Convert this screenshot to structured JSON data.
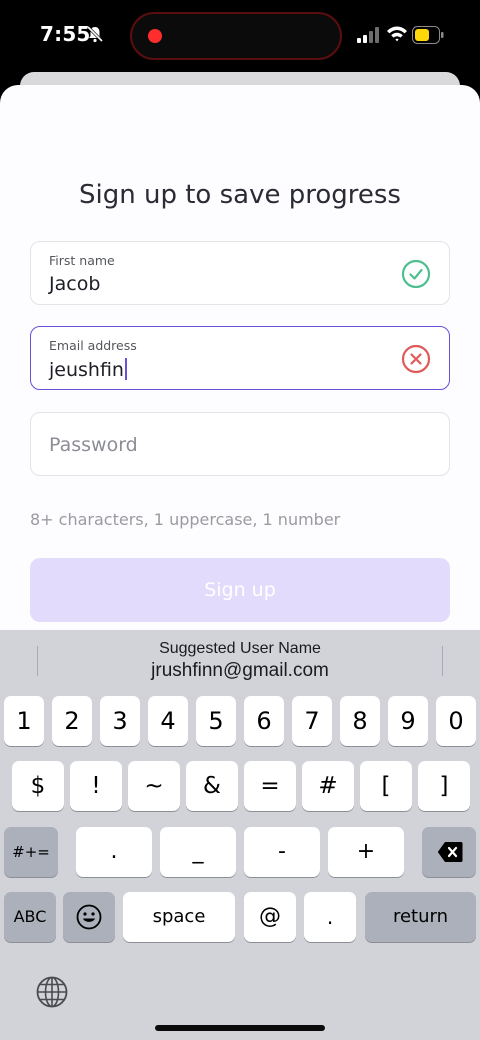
{
  "status_bar": {
    "time": "7:55"
  },
  "form": {
    "title": "Sign up to save progress",
    "first_name": {
      "label": "First name",
      "value": "Jacob",
      "status": "valid"
    },
    "email": {
      "label": "Email address",
      "value": "jeushfin",
      "status": "invalid"
    },
    "password": {
      "placeholder": "Password"
    },
    "hint": "8+ characters, 1 uppercase, 1 number",
    "submit_label": "Sign up"
  },
  "keyboard": {
    "suggestion_title": "Suggested User Name",
    "suggestion_value": "jrushfinn@gmail.com",
    "row1": [
      "1",
      "2",
      "3",
      "4",
      "5",
      "6",
      "7",
      "8",
      "9",
      "0"
    ],
    "row2": [
      "$",
      "!",
      "~",
      "&",
      "=",
      "#",
      "[",
      "]"
    ],
    "row3_switch": "#+=",
    "row3": [
      ".",
      "_",
      "-",
      "+"
    ],
    "abc_label": "ABC",
    "space_label": "space",
    "at_label": "@",
    "dot_label": ".",
    "return_label": "return"
  },
  "colors": {
    "accent": "#6b4fd9",
    "valid": "#4fbf8f",
    "invalid": "#e05a5a",
    "button_disabled": "#e2dbfc"
  }
}
